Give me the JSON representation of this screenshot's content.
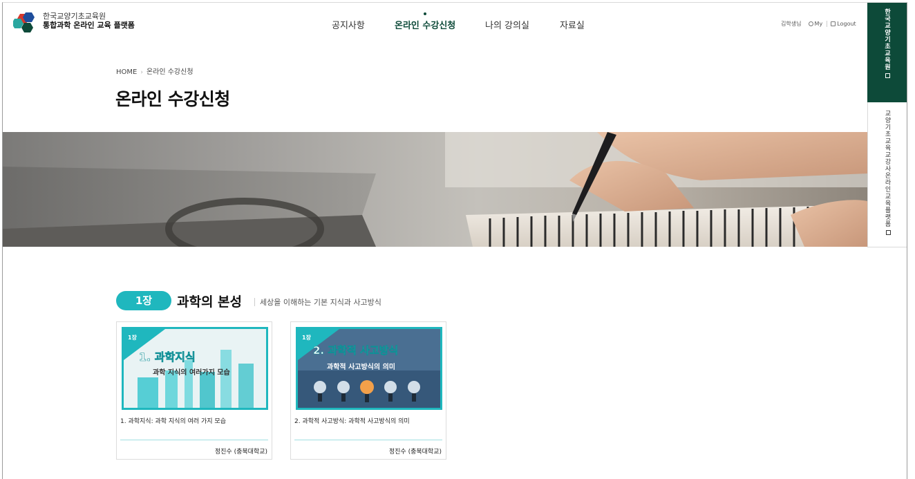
{
  "header": {
    "brand_line1": "한국교양기초교육원",
    "brand_line2": "통합과학 온라인 교육 플랫폼",
    "nav": [
      "공지사항",
      "온라인 수강신청",
      "나의 강의실",
      "자료실"
    ],
    "active_nav": "온라인 수강신청",
    "user_name": "김학생님",
    "my_label": "My",
    "logout_label": "Logout"
  },
  "side_tabs": {
    "tab1": "한국교양기초교육원",
    "tab2": "교양기초교육교강사온라인교육플랫폼"
  },
  "breadcrumb": {
    "home": "HOME",
    "current": "온라인 수강신청"
  },
  "page_title": "온라인 수강신청",
  "chapter": {
    "badge": "1장",
    "title": "과학의 본성",
    "description": "세상을 이해하는 기본 지식과 사고방식"
  },
  "courses": [
    {
      "thumb_badge": "1장",
      "thumb_title": "1. 과학지식",
      "thumb_subtitle": "과학 지식의 여러가지 모습",
      "title": "1. 과학지식: 과학 지식의 여러 가지 모습",
      "author": "정진수 (충북대학교)"
    },
    {
      "thumb_badge": "1장",
      "thumb_title": "2. 과학적 사고방식",
      "thumb_subtitle": "과학적 사고방식의 의미",
      "title": "2. 과학적 사고방식: 과학적 사고방식의 의미",
      "author": "정진수 (충북대학교)"
    }
  ],
  "colors": {
    "brand_dark_green": "#0d4a39",
    "accent_teal": "#1fb7be"
  }
}
